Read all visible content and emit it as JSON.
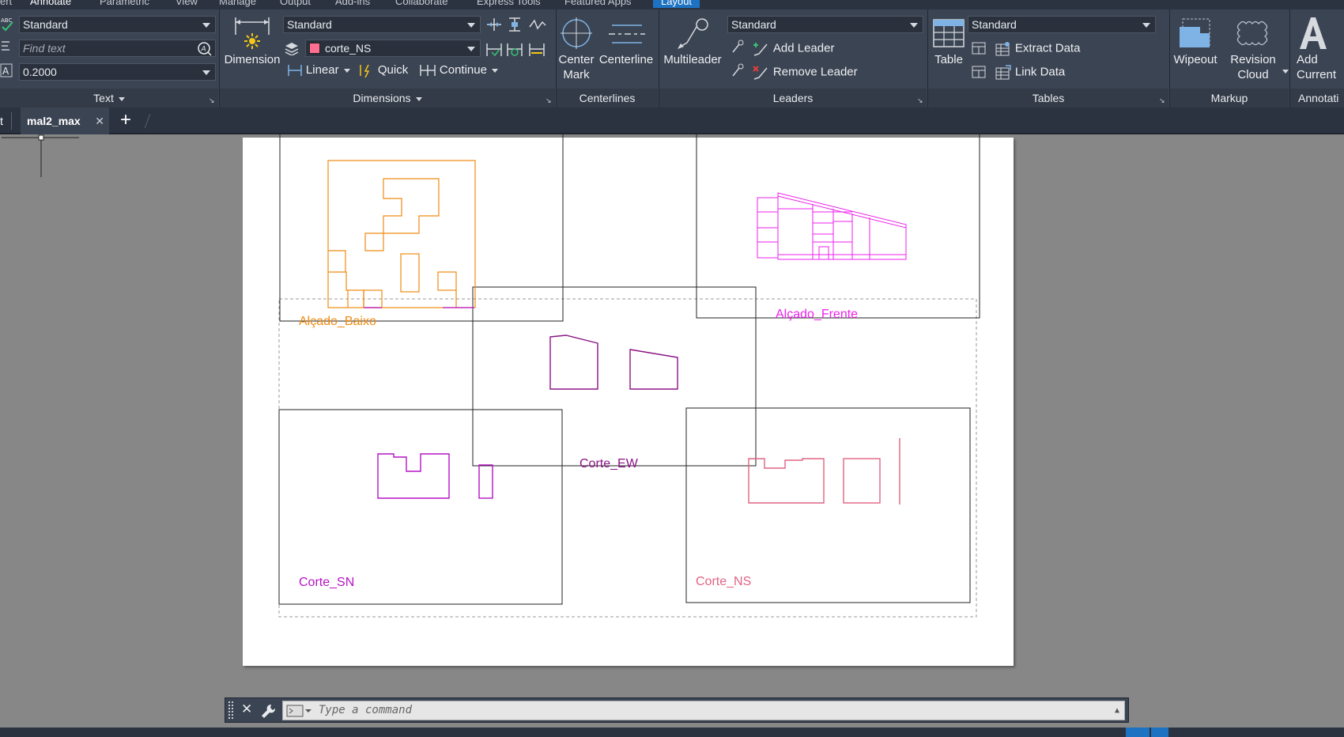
{
  "menu_tabs": [
    "ert",
    "Annotate",
    "Parametric",
    "View",
    "Manage",
    "Output",
    "Add-ins",
    "Collaborate",
    "Express Tools",
    "Featured Apps",
    "Layout"
  ],
  "ribbon": {
    "text_panel": {
      "style_combo": "Standard",
      "find_placeholder": "Find text",
      "height_combo": "0.2000",
      "title": "Text"
    },
    "dimensions_panel": {
      "dimension_label": "Dimension",
      "style_combo": "Standard",
      "layer_combo": "corte_NS",
      "linear_label": "Linear",
      "quick_label": "Quick",
      "continue_label": "Continue",
      "title": "Dimensions"
    },
    "centerlines_panel": {
      "center_mark_label": "Center\nMark",
      "centerline_label": "Centerline",
      "title": "Centerlines"
    },
    "leaders_panel": {
      "multileader_label": "Multileader",
      "style_combo": "Standard",
      "add_leader_label": "Add Leader",
      "remove_leader_label": "Remove Leader",
      "title": "Leaders"
    },
    "tables_panel": {
      "table_label": "Table",
      "style_combo": "Standard",
      "extract_data_label": "Extract Data",
      "link_data_label": "Link Data",
      "title": "Tables"
    },
    "markup_panel": {
      "wipeout_label": "Wipeout",
      "revision_cloud_label": "Revision\nCloud",
      "title": "Markup"
    },
    "annotation_panel": {
      "add_current_label": "Add\nCurrent",
      "title": "Annotati"
    }
  },
  "file_tabs": {
    "left_fragment": "t",
    "active_tab": "mal2_max",
    "close_glyph": "✕",
    "new_tab_glyph": "+"
  },
  "viewports": {
    "alcado_baixo": "Alçado_Baixo",
    "alcado_frente": "Alçado_Frente",
    "corte_ew": "Corte_EW",
    "corte_sn": "Corte_SN",
    "corte_ns": "Corte_NS"
  },
  "colors": {
    "orange": "#f08a10",
    "magenta": "#ee22ee",
    "purple": "#8b1385",
    "violet": "#b712c6",
    "pink": "#e06383",
    "layer_swatch": "#ff6f91",
    "ribbon_bg": "#3b4453",
    "accent_blue": "#1d73c2"
  },
  "command_line": {
    "placeholder": "Type a command"
  }
}
